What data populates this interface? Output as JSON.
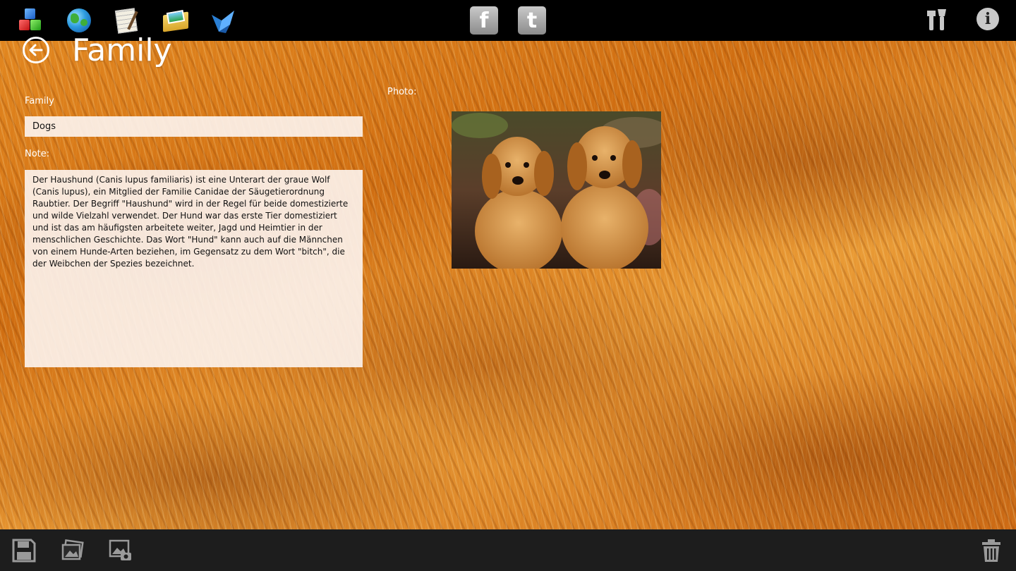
{
  "app": {
    "page_title": "Family"
  },
  "toolbar_top": {
    "left_icons": [
      "blocks-icon",
      "globe-icon",
      "notepad-icon",
      "photo-folder-icon",
      "bird-icon"
    ],
    "center_icons": [
      "facebook-icon",
      "twitter-icon"
    ],
    "right_icons": [
      "tools-icon",
      "info-icon"
    ],
    "facebook_glyph": "f",
    "twitter_glyph": "t",
    "info_glyph": "i"
  },
  "form": {
    "family_label": "Family",
    "family_value": "Dogs",
    "note_label": "Note:",
    "note_value": "Der Haushund (Canis lupus familiaris) ist eine Unterart der graue Wolf (Canis lupus), ein Mitglied der Familie Canidae der Säugetierordnung Raubtier. Der Begriff \"Haushund\" wird in der Regel für beide domestizierte und wilde Vielzahl verwendet. Der Hund war das erste Tier domestiziert und ist das am häufigsten arbeitete weiter, Jagd und Heimtier in der menschlichen Geschichte. Das Wort \"Hund\" kann auch auf die Männchen von einem Hunde-Arten beziehen, im Gegensatz zu dem Wort \"bitch\", die der Weibchen der Spezies bezeichnet.",
    "photo_label": "Photo:"
  },
  "toolbar_bottom": {
    "left_icons": [
      "save-icon",
      "pick-photo-icon",
      "camera-photo-icon"
    ],
    "right_icons": [
      "trash-icon"
    ]
  },
  "colors": {
    "topbar_bg": "#000000",
    "bottombar_bg": "#1d1d1d",
    "field_bg": "#fcf2ec",
    "icon_gray": "#9a9a9a"
  }
}
